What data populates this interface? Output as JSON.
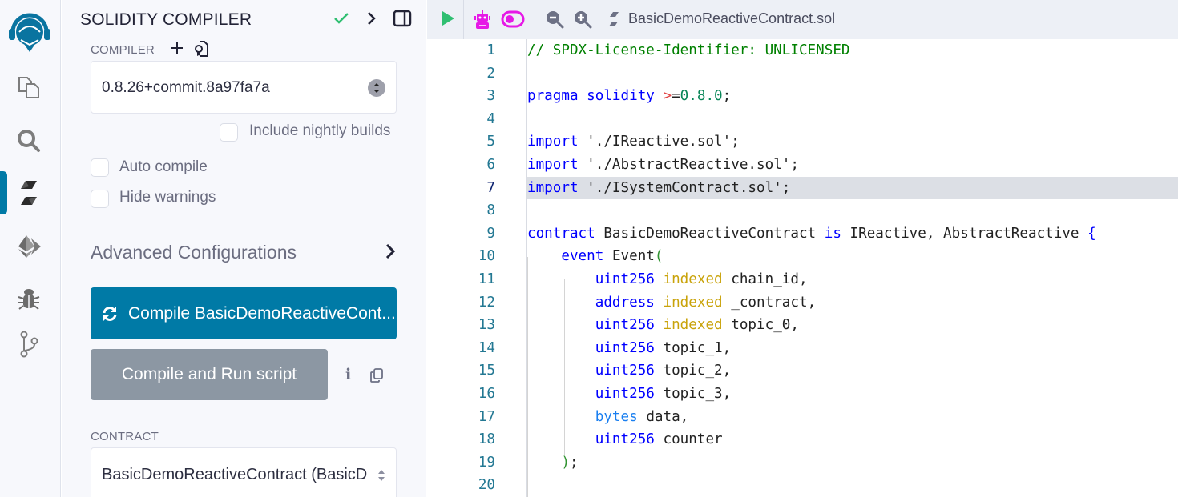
{
  "icon_panel": {
    "items": [
      {
        "name": "remix-logo-icon"
      },
      {
        "name": "file-explorer-icon"
      },
      {
        "name": "search-icon"
      },
      {
        "name": "solidity-compiler-icon",
        "active": true
      },
      {
        "name": "deploy-run-icon"
      },
      {
        "name": "debugger-icon"
      },
      {
        "name": "git-icon"
      }
    ]
  },
  "side_panel": {
    "title": "SOLIDITY COMPILER",
    "compiler_label": "COMPILER",
    "compiler_version": "0.8.26+commit.8a97fa7a",
    "include_nightly_label": "Include nightly builds",
    "include_nightly_checked": false,
    "auto_compile_label": "Auto compile",
    "auto_compile_checked": false,
    "hide_warnings_label": "Hide warnings",
    "hide_warnings_checked": false,
    "advanced_label": "Advanced Configurations",
    "compile_button": "Compile BasicDemoReactiveCont...",
    "compile_run_button": "Compile and Run script",
    "info_glyph": "i",
    "contract_label": "CONTRACT",
    "contract_value": "BasicDemoReactiveContract (BasicD"
  },
  "editor": {
    "tab_name": "BasicDemoReactiveContract.sol",
    "colors": {
      "accent": "#007aa6",
      "run": "#2fbf71",
      "ai": "#e619e6"
    },
    "lines": [
      {
        "n": "1"
      },
      {
        "n": "2"
      },
      {
        "n": "3"
      },
      {
        "n": "4"
      },
      {
        "n": "5"
      },
      {
        "n": "6"
      },
      {
        "n": "7"
      },
      {
        "n": "8"
      },
      {
        "n": "9"
      },
      {
        "n": "10"
      },
      {
        "n": "11"
      },
      {
        "n": "12"
      },
      {
        "n": "13"
      },
      {
        "n": "14"
      },
      {
        "n": "15"
      },
      {
        "n": "16"
      },
      {
        "n": "17"
      },
      {
        "n": "18"
      },
      {
        "n": "19"
      },
      {
        "n": "20"
      }
    ],
    "tokens": {
      "l1": "// SPDX-License-Identifier: UNLICENSED",
      "l3_kw": "pragma solidity",
      "l3_op": ">",
      "l3_eq": "=",
      "l3_ver": "0.8.0",
      "l3_end": ";",
      "import_kw": "import",
      "l5_str": "'./IReactive.sol'",
      "l6_str": "'./AbstractReactive.sol'",
      "l7_str": "'./ISystemContract.sol'",
      "semi": ";",
      "l9_kw": "contract",
      "l9_name": "BasicDemoReactiveContract",
      "l9_is": "is",
      "l9_bases": "IReactive, AbstractReactive",
      "l9_brace": "{",
      "l10_kw": "event",
      "l10_name": "Event",
      "l10_paren": "(",
      "uint256": "uint256",
      "address": "address",
      "bytes": "bytes",
      "indexed": "indexed",
      "l11_id": "chain_id,",
      "l12_id": "_contract,",
      "l13_id": "topic_0,",
      "l14_id": "topic_1,",
      "l15_id": "topic_2,",
      "l16_id": "topic_3,",
      "l17_id": "data,",
      "l18_id": "counter",
      "l19_paren": ")",
      "l19_semi": ";"
    }
  }
}
